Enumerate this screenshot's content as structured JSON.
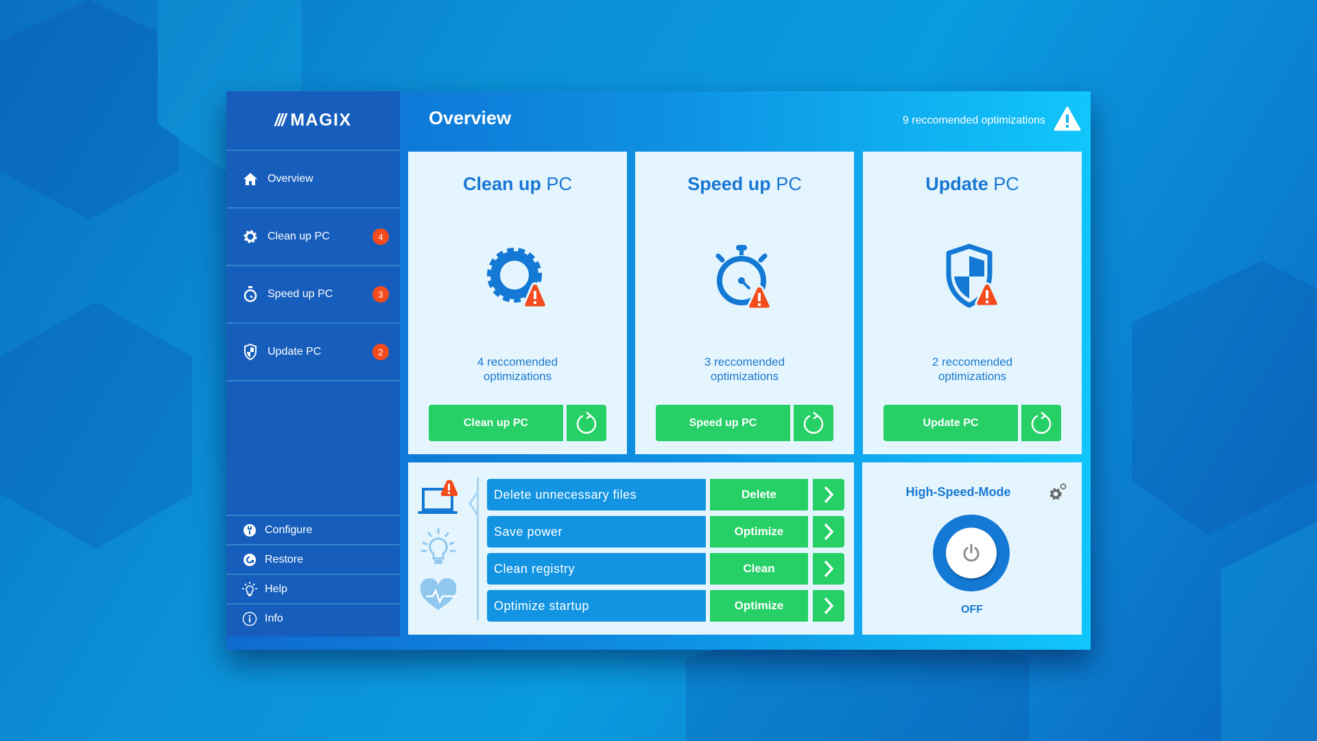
{
  "app": {
    "brand": "MAGIX",
    "colors": {
      "sidebar": "#175ebc",
      "accent_blue": "#1777d4",
      "action_green": "#26d066",
      "badge_red": "#f44a1c",
      "card_bg": "#e5f5fd"
    }
  },
  "sidebar": {
    "items": [
      {
        "label": "Overview",
        "icon": "home-icon"
      },
      {
        "label": "Clean up PC",
        "icon": "gear-icon",
        "badge": "4"
      },
      {
        "label": "Speed up PC",
        "icon": "stopwatch-icon",
        "badge": "3"
      },
      {
        "label": "Update PC",
        "icon": "shield-icon",
        "badge": "2"
      }
    ],
    "bottom_items": [
      {
        "label": "Configure",
        "icon": "wrench-icon"
      },
      {
        "label": "Restore",
        "icon": "restore-icon"
      },
      {
        "label": "Help",
        "icon": "lightbulb-icon"
      },
      {
        "label": "Info",
        "icon": "info-icon"
      }
    ]
  },
  "header": {
    "title": "Overview",
    "recommendations": "9 reccomended optimizations",
    "warning_icon": "warning-icon"
  },
  "cards": [
    {
      "title_bold": "Clean up",
      "title_rest": " PC",
      "desc_line1": "4 reccomended",
      "desc_line2": "optimizations",
      "button": "Clean up PC",
      "icon": "gear-alert-icon"
    },
    {
      "title_bold": "Speed up",
      "title_rest": " PC",
      "desc_line1": "3 reccomended",
      "desc_line2": "optimizations",
      "button": "Speed up PC",
      "icon": "stopwatch-alert-icon"
    },
    {
      "title_bold": "Update",
      "title_rest": " PC",
      "desc_line1": "2 reccomended",
      "desc_line2": "optimizations",
      "button": "Update PC",
      "icon": "shield-alert-icon"
    }
  ],
  "tasks": [
    {
      "label": "Delete unnecessary files",
      "action": "Delete"
    },
    {
      "label": "Save power",
      "action": "Optimize"
    },
    {
      "label": "Clean registry",
      "action": "Clean"
    },
    {
      "label": "Optimize startup",
      "action": "Optimize"
    }
  ],
  "high_speed_mode": {
    "title": "High-Speed-Mode",
    "state": "OFF"
  }
}
